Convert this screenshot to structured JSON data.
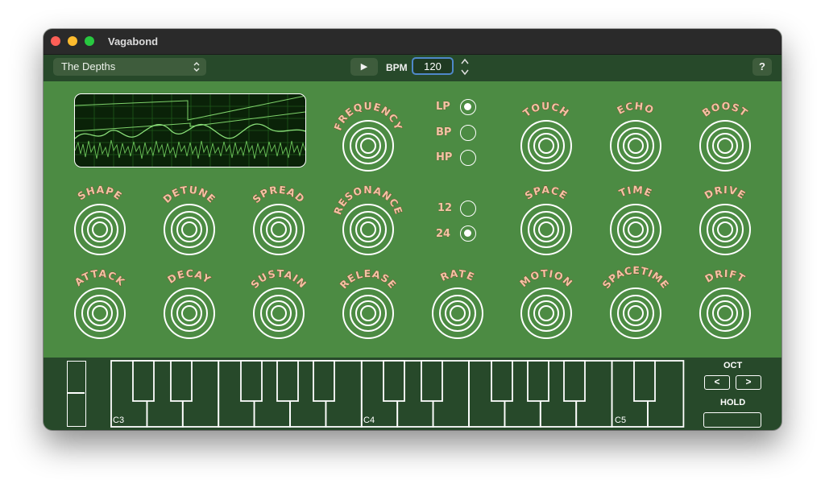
{
  "window": {
    "title": "Vagabond"
  },
  "toolbar": {
    "preset": "The Depths",
    "preset_chevron": "⌃⌄",
    "play_icon": "▶",
    "bpm_label": "BPM",
    "bpm_value": "120",
    "stepper_up": "▲",
    "stepper_down": "▼",
    "help_label": "?"
  },
  "filter": {
    "types": [
      {
        "label": "LP",
        "selected": true
      },
      {
        "label": "BP",
        "selected": false
      },
      {
        "label": "HP",
        "selected": false
      }
    ],
    "slopes": [
      {
        "label": "12",
        "selected": false
      },
      {
        "label": "24",
        "selected": true
      }
    ]
  },
  "knobs": {
    "frequency": "FREQUENCY",
    "resonance": "RESONANCE",
    "touch": "TOUCH",
    "echo": "ECHO",
    "boost": "BOOST",
    "shape": "SHAPE",
    "detune": "DETUNE",
    "spread": "SPREAD",
    "space": "SPACE",
    "time": "TIME",
    "drive": "DRIVE",
    "attack": "ATTACK",
    "decay": "DECAY",
    "sustain": "SUSTAIN",
    "release": "RELEASE",
    "rate": "RATE",
    "motion": "MOTION",
    "spacetime": "SPACETIME",
    "drift": "DRIFT"
  },
  "keyboard": {
    "labels": [
      "C3",
      "C4",
      "C5"
    ]
  },
  "octave": {
    "label": "OCT",
    "down": "<",
    "up": ">",
    "hold_label": "HOLD"
  },
  "colors": {
    "panel": "#4c8b43",
    "dark_panel": "#27492a",
    "knob_label": "#f3c3a4",
    "accent_focus": "#4f88c9"
  }
}
